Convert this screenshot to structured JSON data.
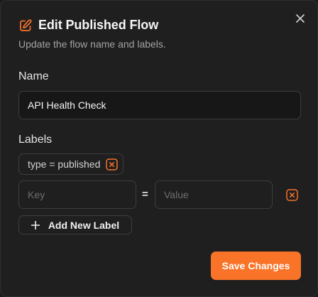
{
  "dialog": {
    "title": "Edit Published Flow",
    "subtitle": "Update the flow name and labels.",
    "title_icon": "edit-icon",
    "close_icon": "close-icon"
  },
  "name_section": {
    "label": "Name",
    "value": "API Health Check"
  },
  "labels_section": {
    "label": "Labels",
    "existing": [
      {
        "text": "type = published",
        "remove_icon": "x-square-icon"
      }
    ],
    "new_row": {
      "key_placeholder": "Key",
      "value_placeholder": "Value",
      "separator": "=",
      "remove_icon": "x-square-icon"
    },
    "add_button_label": "Add New Label",
    "add_icon": "plus-icon"
  },
  "actions": {
    "save_label": "Save Changes"
  },
  "colors": {
    "accent": "#f97328",
    "background": "#1f1f20",
    "border": "#3d3d40"
  }
}
